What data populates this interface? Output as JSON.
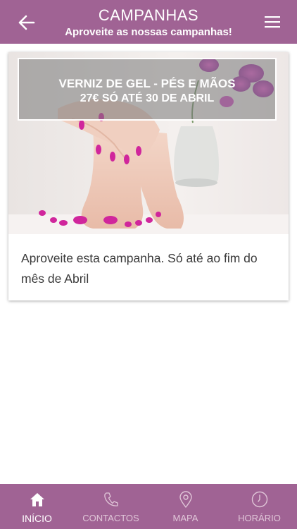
{
  "header": {
    "title": "CAMPANHAS",
    "subtitle": "Aproveite as nossas campanhas!",
    "back_icon": "arrow-left-icon",
    "menu_icon": "hamburger-menu-icon"
  },
  "campaign": {
    "banner_line1": "VERNIZ DE GEL - PÉS E MÃOS",
    "banner_line2": "27€ SÓ ATÉ 30 DE ABRIL",
    "description": "Aproveite esta campanha. Só até ao fim do mês de Abril"
  },
  "tabs": [
    {
      "label": "INÍCIO",
      "icon": "home-icon",
      "active": true
    },
    {
      "label": "CONTACTOS",
      "icon": "phone-icon",
      "active": false
    },
    {
      "label": "MAPA",
      "icon": "map-pin-icon",
      "active": false
    },
    {
      "label": "HORÁRIO",
      "icon": "clock-icon",
      "active": false
    }
  ],
  "colors": {
    "brand": "#a06394",
    "tab_inactive": "#e0c6d8",
    "nail_polish": "#d0269c"
  }
}
